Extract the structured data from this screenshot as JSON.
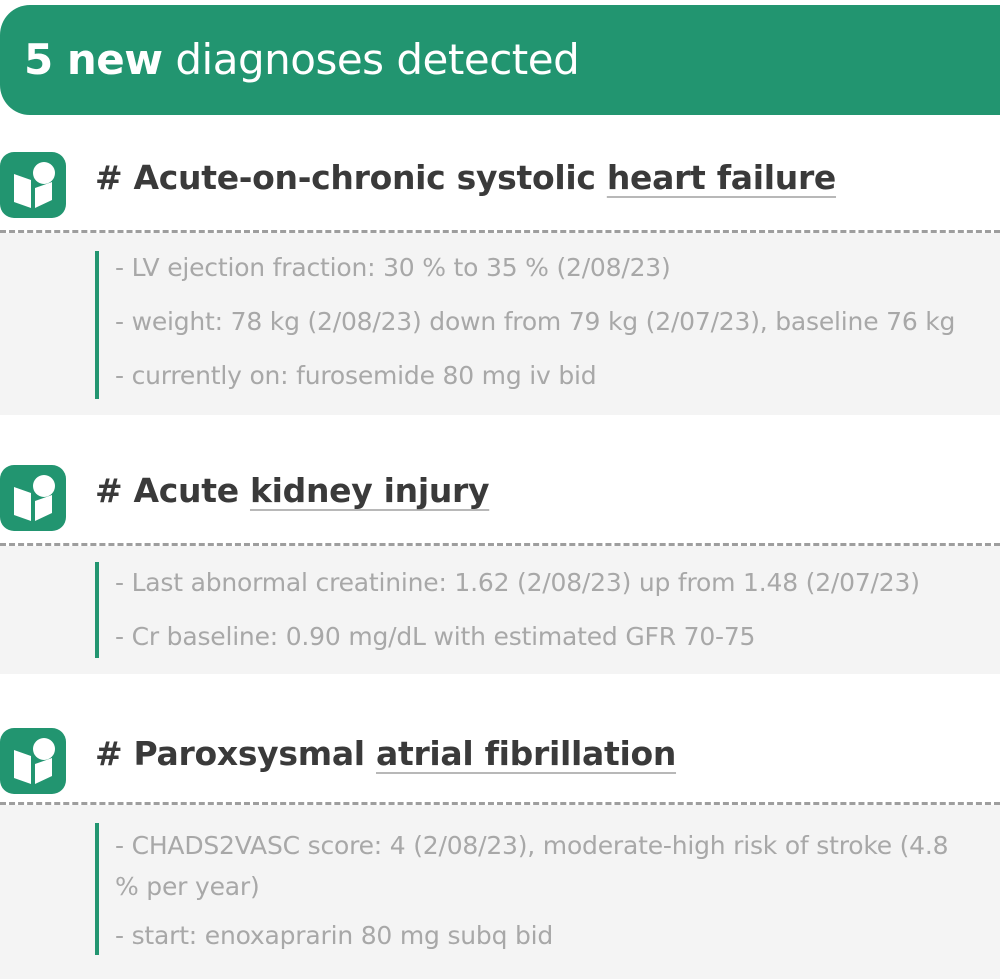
{
  "banner": {
    "count": "5 new",
    "text": " diagnoses detected"
  },
  "diagnoses": [
    {
      "prefix": "# Acute-on-chronic systolic ",
      "term": "heart failure",
      "details": [
        "- LV ejection fraction: 30 % to 35 % (2/08/23)",
        "- weight: 78 kg (2/08/23) down from 79 kg (2/07/23), baseline 76 kg",
        "- currently on: furosemide 80 mg iv bid"
      ]
    },
    {
      "prefix": "# Acute ",
      "term": "kidney injury",
      "details": [
        "- Last abnormal creatinine: 1.62 (2/08/23) up from 1.48 (2/07/23)",
        "- Cr baseline: 0.90 mg/dL with estimated GFR 70-75"
      ]
    },
    {
      "prefix": "# Paroxsysmal ",
      "term": "atrial fibrillation",
      "details": [
        "- CHADS2VASC score: 4 (2/08/23), moderate-high risk of stroke (4.8 % per year)",
        "- start: enoxaprarin 80 mg subq bid"
      ]
    }
  ],
  "colors": {
    "brand_green": "#229570",
    "detail_text": "#a8a8a8",
    "title_text": "#3a3a3a"
  },
  "icon": "app-logo-icon"
}
